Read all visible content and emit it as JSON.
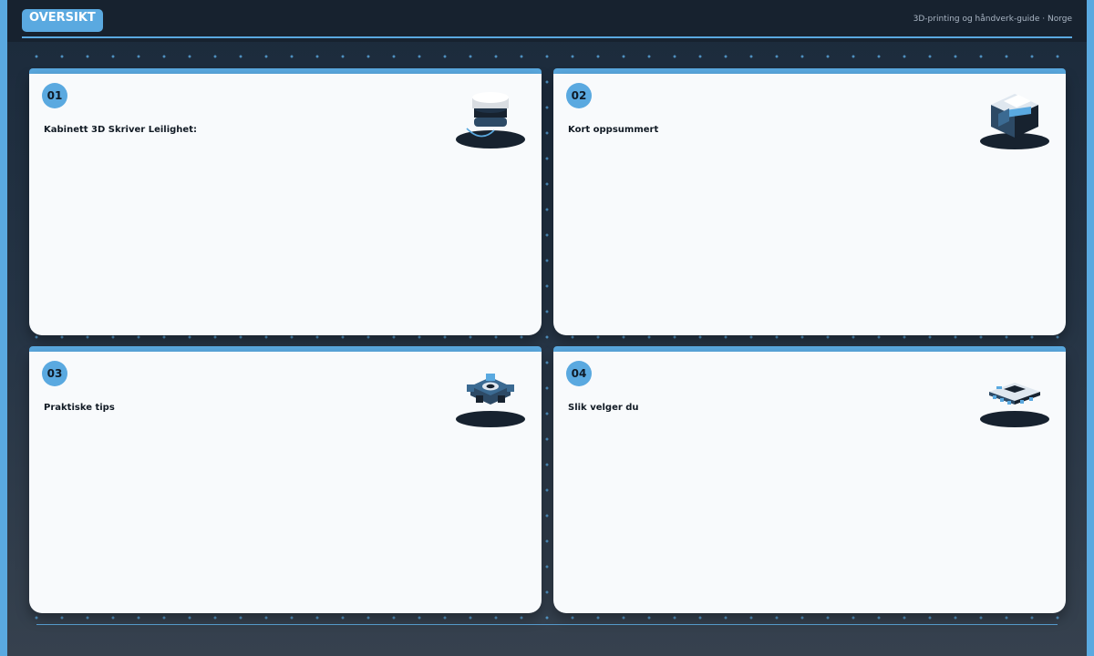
{
  "header": {
    "title": "OVERSIKT",
    "subtitle": "3D-printing og håndverk-guide · Norge"
  },
  "cards": [
    {
      "number": "01",
      "title": "Kabinett 3D Skriver Leilighet:",
      "icon": "spool-icon"
    },
    {
      "number": "02",
      "title": "Kort oppsummert",
      "icon": "cube-block-icon"
    },
    {
      "number": "03",
      "title": "Praktiske tips",
      "icon": "gear-icon"
    },
    {
      "number": "04",
      "title": "Slik velger du",
      "icon": "circuit-board-icon"
    }
  ],
  "colors": {
    "accent": "#5aa9e0",
    "dark": "#17222f",
    "card": "#f8fafc"
  }
}
